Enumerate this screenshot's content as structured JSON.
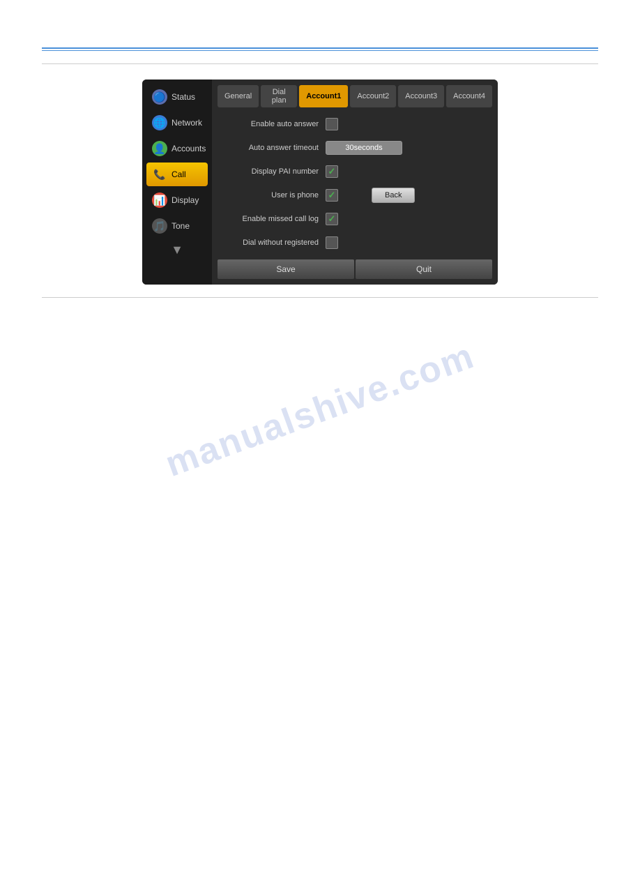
{
  "page": {
    "watermark": "manualshive.com"
  },
  "tabs": {
    "items": [
      {
        "label": "General",
        "active": false
      },
      {
        "label": "Dial plan",
        "active": false
      },
      {
        "label": "Account1",
        "active": true
      },
      {
        "label": "Account2",
        "active": false
      },
      {
        "label": "Account3",
        "active": false
      },
      {
        "label": "Account4",
        "active": false
      }
    ]
  },
  "sidebar": {
    "items": [
      {
        "label": "Status",
        "icon": "🔵",
        "iconClass": "icon-status",
        "active": false
      },
      {
        "label": "Network",
        "icon": "🌐",
        "iconClass": "icon-network",
        "active": false
      },
      {
        "label": "Accounts",
        "icon": "👤",
        "iconClass": "icon-accounts",
        "active": false
      },
      {
        "label": "Call",
        "icon": "📞",
        "iconClass": "icon-call",
        "active": true
      },
      {
        "label": "Display",
        "icon": "📊",
        "iconClass": "icon-display",
        "active": false
      },
      {
        "label": "Tone",
        "icon": "🎵",
        "iconClass": "icon-tone",
        "active": false
      }
    ],
    "down_arrow": "▼"
  },
  "form": {
    "fields": [
      {
        "label": "Enable auto answer",
        "type": "checkbox",
        "checked": false
      },
      {
        "label": "Auto answer timeout",
        "type": "text",
        "value": "30seconds"
      },
      {
        "label": "Display PAI number",
        "type": "checkbox",
        "checked": true
      },
      {
        "label": "User is phone",
        "type": "checkbox",
        "checked": true,
        "has_back": true
      },
      {
        "label": "Enable missed call log",
        "type": "checkbox",
        "checked": true
      },
      {
        "label": "Dial without registered",
        "type": "checkbox",
        "checked": false
      }
    ],
    "back_label": "Back",
    "save_label": "Save",
    "quit_label": "Quit"
  }
}
